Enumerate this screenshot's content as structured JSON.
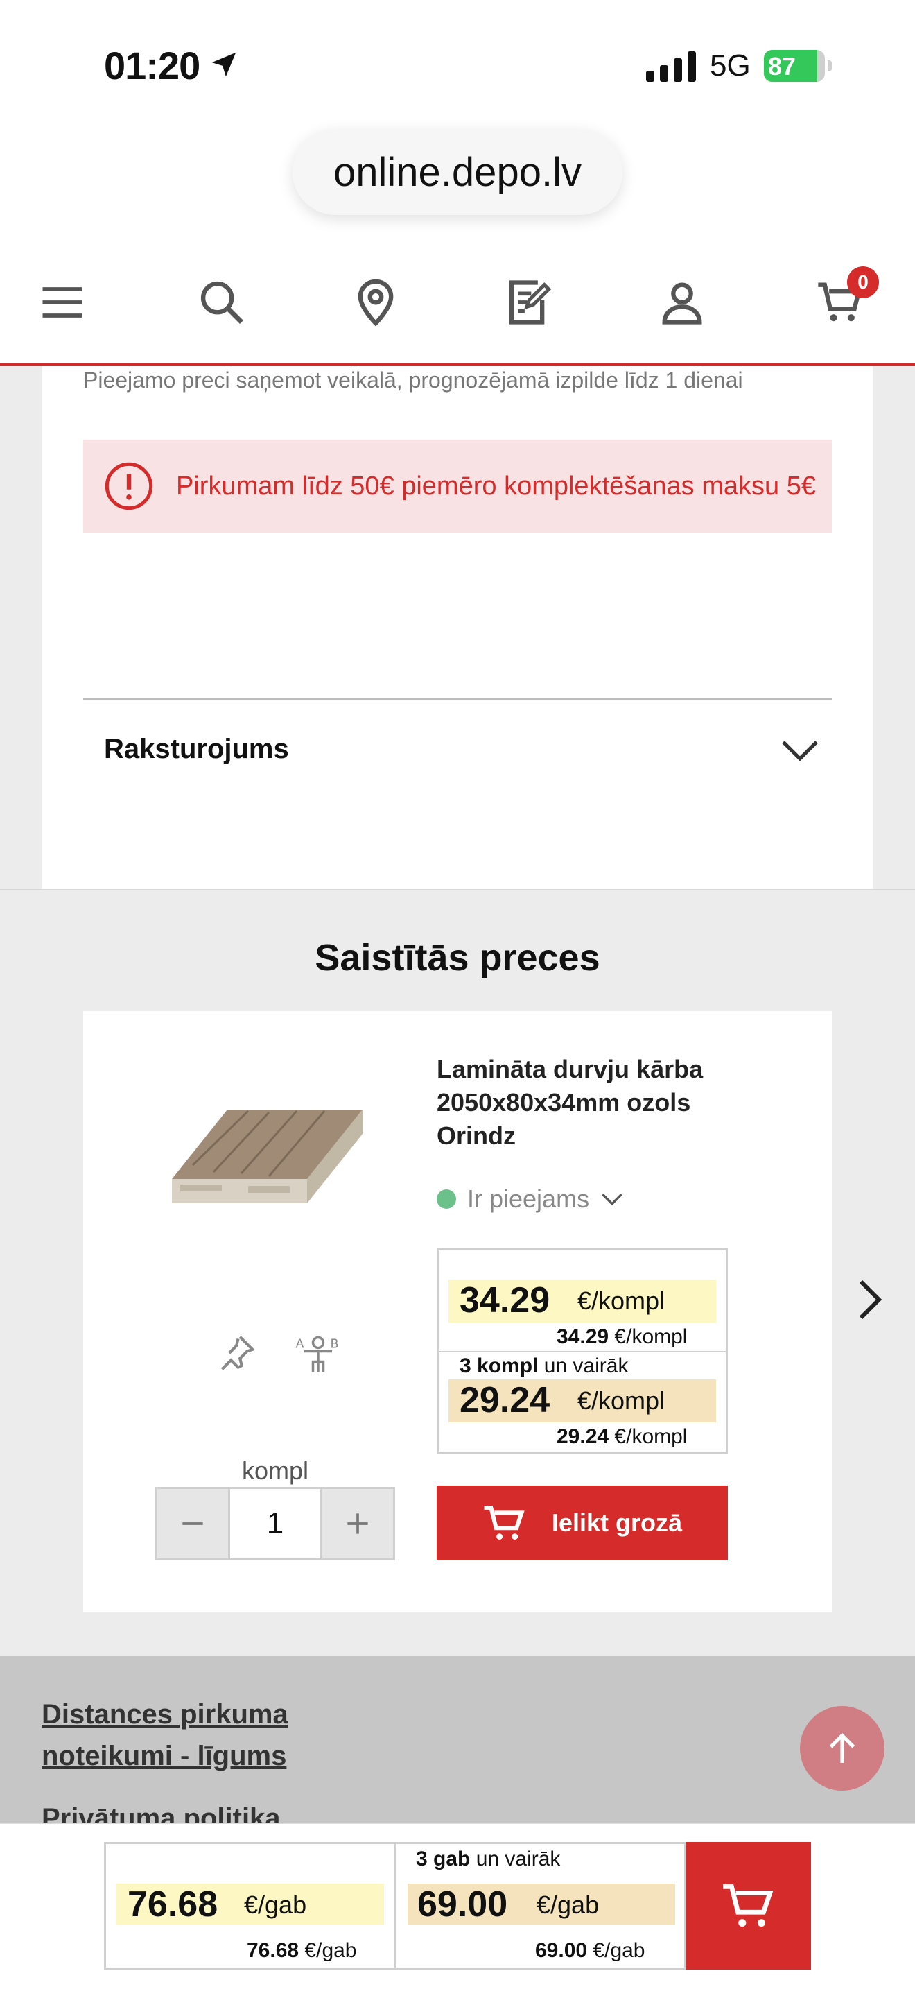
{
  "status_bar": {
    "time": "01:20",
    "network": "5G",
    "battery": "87",
    "battery_level": 0.87
  },
  "browser": {
    "url": "online.depo.lv"
  },
  "nav": {
    "cart_count": "0"
  },
  "availability_note": "Pieejamo preci saņemot veikalā, prognozējamā izpilde līdz 1 dienai",
  "alert": {
    "text": "Pirkumam līdz 50€ piemēro komplektēšanas maksu 5€"
  },
  "accordion": {
    "title": "Raksturojums"
  },
  "related": {
    "title": "Saistītās preces",
    "product": {
      "name": "Lamināta durvju kārba 2050x80x34mm ozols Orindz",
      "stock": "Ir pieejams",
      "price_main": "34.29",
      "price_main_unit": "€/kompl",
      "price_sub": "34.29",
      "price_sub_unit": "€/kompl",
      "bulk_qty": "3 kompl",
      "bulk_text": "un vairāk",
      "bulk_price": "29.24",
      "bulk_unit": "€/kompl",
      "bulk_sub": "29.24",
      "bulk_sub_unit": "€/kompl",
      "qty_unit": "kompl",
      "qty_value": "1",
      "add_label": "Ielikt grozā"
    }
  },
  "footer": {
    "link1_line1": "Distances pirkuma",
    "link1_line2": "noteikumi - līgums",
    "link2": "Privātuma politika"
  },
  "sticky": {
    "price": "76.68",
    "unit": "€/gab",
    "price_sub": "76.68",
    "unit_sub": "€/gab",
    "bulk_qty": "3 gab",
    "bulk_text": "un vairāk",
    "bulk_price": "69.00",
    "bulk_unit": "€/gab",
    "bulk_sub": "69.00",
    "bulk_sub_unit": "€/gab"
  }
}
